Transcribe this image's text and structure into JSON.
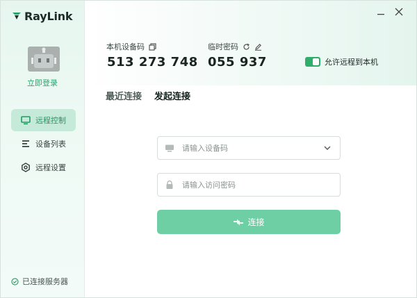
{
  "app": {
    "name": "RayLink"
  },
  "sidebar": {
    "login_label": "立即登录",
    "items": [
      {
        "label": "远程控制",
        "icon": "monitor-icon",
        "active": true
      },
      {
        "label": "设备列表",
        "icon": "list-icon",
        "active": false
      },
      {
        "label": "远程设置",
        "icon": "settings-icon",
        "active": false
      }
    ],
    "status_label": "已连接服务器"
  },
  "header": {
    "device_code_label": "本机设备码",
    "device_code": "513 273 748",
    "temp_password_label": "临时密码",
    "temp_password": "055 937",
    "allow_remote_label": "允许远程到本机",
    "allow_remote_enabled": true
  },
  "tabs": [
    {
      "label": "最近连接",
      "active": false
    },
    {
      "label": "发起连接",
      "active": true
    }
  ],
  "form": {
    "device_placeholder": "请输入设备码",
    "password_placeholder": "请输入访问密码",
    "connect_label": "连接"
  },
  "colors": {
    "accent": "#2fae6b",
    "accent_light": "#6fcfa4",
    "nav_active_bg": "#c5ead9",
    "sidebar_bg": "#e6f6ef"
  }
}
